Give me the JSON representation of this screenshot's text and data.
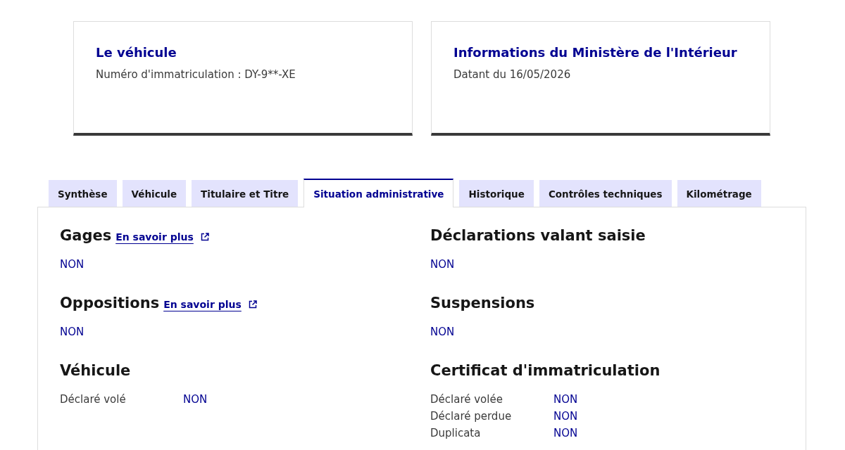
{
  "cards": [
    {
      "title": "Le véhicule",
      "text": "Numéro d'immatriculation : DY-9**-XE"
    },
    {
      "title": "Informations du Ministère de l'Intérieur",
      "text": "Datant du 16/05/2026"
    }
  ],
  "tabs": [
    {
      "label": "Synthèse",
      "selected": false
    },
    {
      "label": "Véhicule",
      "selected": false
    },
    {
      "label": "Titulaire et Titre",
      "selected": false
    },
    {
      "label": "Situation administrative",
      "selected": true
    },
    {
      "label": "Historique",
      "selected": false
    },
    {
      "label": "Contrôles techniques",
      "selected": false
    },
    {
      "label": "Kilométrage",
      "selected": false
    }
  ],
  "columns": [
    [
      {
        "kind": "value",
        "title": "Gages",
        "link": "En savoir plus",
        "value": "NON"
      },
      {
        "kind": "value",
        "title": "Oppositions",
        "link": "En savoir plus",
        "value": "NON"
      },
      {
        "kind": "rows",
        "title": "Véhicule",
        "rows": [
          {
            "label": "Déclaré volé",
            "value": "NON"
          }
        ]
      }
    ],
    [
      {
        "kind": "value",
        "title": "Déclarations valant saisie",
        "value": "NON"
      },
      {
        "kind": "value",
        "title": "Suspensions",
        "value": "NON"
      },
      {
        "kind": "rows",
        "title": "Certificat d'immatriculation",
        "rows": [
          {
            "label": "Déclaré volée",
            "value": "NON"
          },
          {
            "label": "Déclaré perdue",
            "value": "NON"
          },
          {
            "label": "Duplicata",
            "value": "NON"
          }
        ]
      }
    ]
  ]
}
